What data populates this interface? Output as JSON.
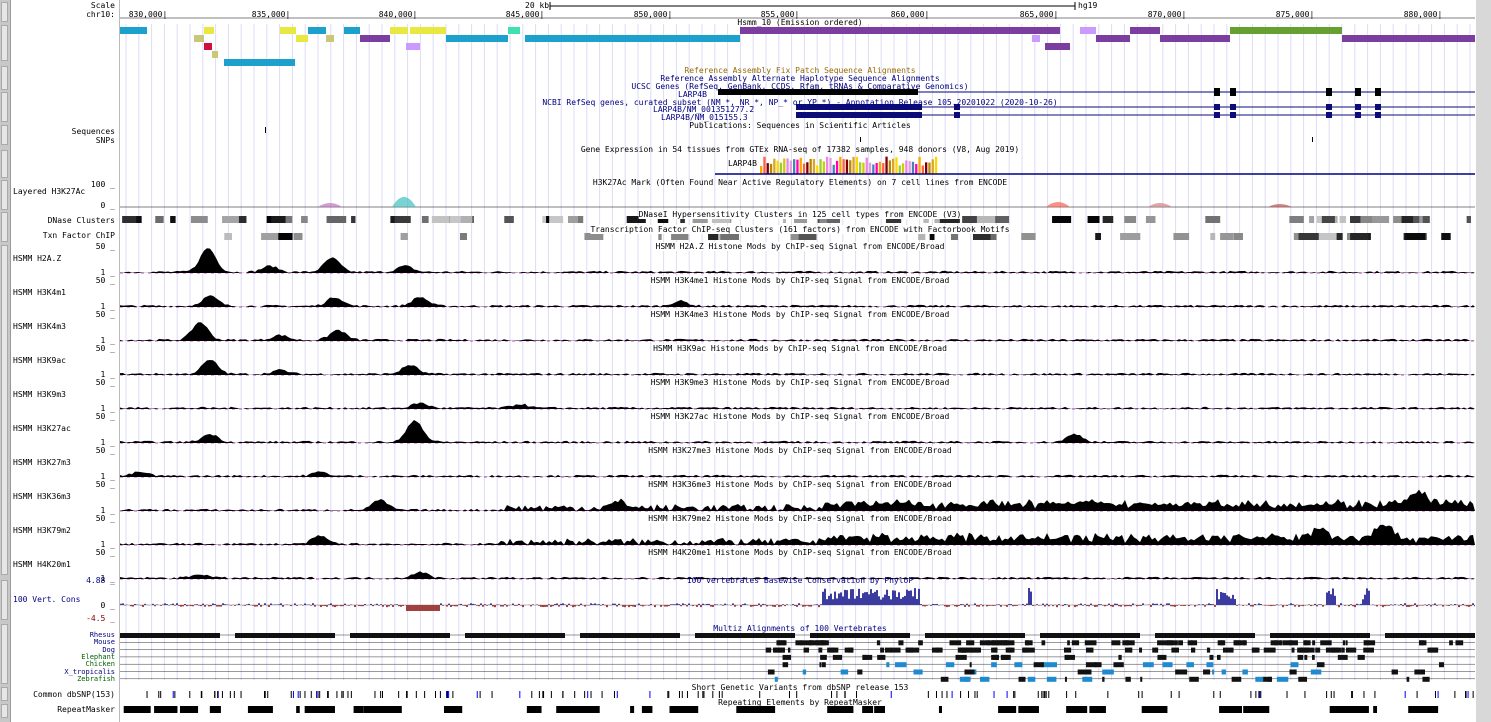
{
  "ruler": {
    "scale_label": "Scale",
    "chrom_label": "chr10:",
    "scale_text": "20 kb",
    "assembly": "hg19",
    "positions": [
      "830,000|",
      "835,000|",
      "840,000|",
      "845,000|",
      "850,000|",
      "855,000|",
      "860,000|",
      "865,000|",
      "870,000|",
      "875,000|",
      "880,000|"
    ]
  },
  "chromhmm_title": "Hsmm_10 (Emission ordered)",
  "track_titles": {
    "fix_patch": "Reference Assembly Fix Patch Sequence Alignments",
    "alt_haplo": "Reference Assembly Alternate Haplotype Sequence Alignments",
    "ucsc_genes": "UCSC Genes (RefSeq, GenBank, CCDS, Rfam, tRNAs & Comparative Genomics)",
    "refseq": "NCBI RefSeq genes, curated subset (NM_*, NR_*, NP_* or YP_*) - Annotation Release 105.20201022 (2020-10-26)",
    "publications": "Publications: Sequences in Scientific Articles",
    "gtex": "Gene Expression in 54 tissues from GTEx RNA-seq of 17382 samples, 948 donors (V8, Aug 2019)",
    "h3k27ac": "H3K27Ac Mark (Often Found Near Active Regulatory Elements) on 7 cell lines from ENCODE",
    "dnase": "DNaseI Hypersensitivity Clusters in 125 cell types from ENCODE (V3)",
    "txn": "Transcription Factor ChIP-seq Clusters (161 factors) from ENCODE with Factorbook Motifs",
    "cons": "100 vertebrates Basewise Conservation by PhyloP",
    "multiz": "Multiz Alignments of 100 Vertebrates",
    "dbsnp": "Short Genetic Variants from dbSNP release 153",
    "rmsk": "Repeating Elements by RepeatMasker"
  },
  "gene_labels": {
    "ucsc": "LARP4B",
    "refseq_1": "LARP4B/NM_001351277.2",
    "refseq_2": "LARP4B/NM_015155.3",
    "gtex": "LARP4B"
  },
  "left_labels": {
    "sequences": "Sequences",
    "snps": "SNPs",
    "layered": "Layered H3K27Ac",
    "layered_max": "100 _",
    "layered_min": "0 _",
    "dnase": "DNase Clusters",
    "txn": "Txn Factor ChIP",
    "vert_cons": "100 Vert. Cons",
    "cons_max": "4.88 _",
    "cons_zero": "0 _",
    "cons_min": "-4.5 _",
    "dbsnp": "Common dbSNP(153)",
    "rmsk": "RepeatMasker"
  },
  "histone_tracks": [
    {
      "label": "HSMM H2A.Z",
      "title": "HSMM H2A.Z Histone Mods by ChIP-seq Signal from ENCODE/Broad",
      "max": "50 _",
      "min": "1 _"
    },
    {
      "label": "HSMM H3K4m1",
      "title": "HSMM H3K4me1 Histone Mods by ChIP-seq Signal from ENCODE/Broad",
      "max": "50 _",
      "min": "1 _"
    },
    {
      "label": "HSMM H3K4m3",
      "title": "HSMM H3K4me3 Histone Mods by ChIP-seq Signal from ENCODE/Broad",
      "max": "50 _",
      "min": "1 _"
    },
    {
      "label": "HSMM H3K9ac",
      "title": "HSMM H3K9ac Histone Mods by ChIP-seq Signal from ENCODE/Broad",
      "max": "50 _",
      "min": "1 _"
    },
    {
      "label": "HSMM H3K9m3",
      "title": "HSMM H3K9me3 Histone Mods by ChIP-seq Signal from ENCODE/Broad",
      "max": "50 _",
      "min": "1 _"
    },
    {
      "label": "HSMM H3K27ac",
      "title": "HSMM H3K27ac Histone Mods by ChIP-seq Signal from ENCODE/Broad",
      "max": "50 _",
      "min": "1 _"
    },
    {
      "label": "HSMM H3K27m3",
      "title": "HSMM H3K27me3 Histone Mods by ChIP-seq Signal from ENCODE/Broad",
      "max": "50 _",
      "min": "1 _"
    },
    {
      "label": "HSMM H3K36m3",
      "title": "HSMM H3K36me3 Histone Mods by ChIP-seq Signal from ENCODE/Broad",
      "max": "50 _",
      "min": "1 _"
    },
    {
      "label": "HSMM H3K79m2",
      "title": "HSMM H3K79me2 Histone Mods by ChIP-seq Signal from ENCODE/Broad",
      "max": "50 _",
      "min": "1 _"
    },
    {
      "label": "HSMM H4K20m1",
      "title": "HSMM H4K20me1 Histone Mods by ChIP-seq Signal from ENCODE/Broad",
      "max": "50 _",
      "min": "1 _"
    }
  ],
  "species": [
    {
      "name": "Rhesus",
      "color": "#000080"
    },
    {
      "name": "Mouse",
      "color": "#000080"
    },
    {
      "name": "Dog",
      "color": "#000080"
    },
    {
      "name": "Elephant",
      "color": "#006400"
    },
    {
      "name": "Chicken",
      "color": "#006400"
    },
    {
      "name": "X_tropicalis",
      "color": "#000080"
    },
    {
      "name": "Zebrafish",
      "color": "#006400"
    }
  ],
  "colors": {
    "title_blue": "#000080",
    "fix_patch": "#9a6a00",
    "grid": "#d8d8ff",
    "refseq": "#0c0c78",
    "cons_pos": "#3c3ca0",
    "cons_neg": "#a04040",
    "magenta": "#c000c0"
  }
}
